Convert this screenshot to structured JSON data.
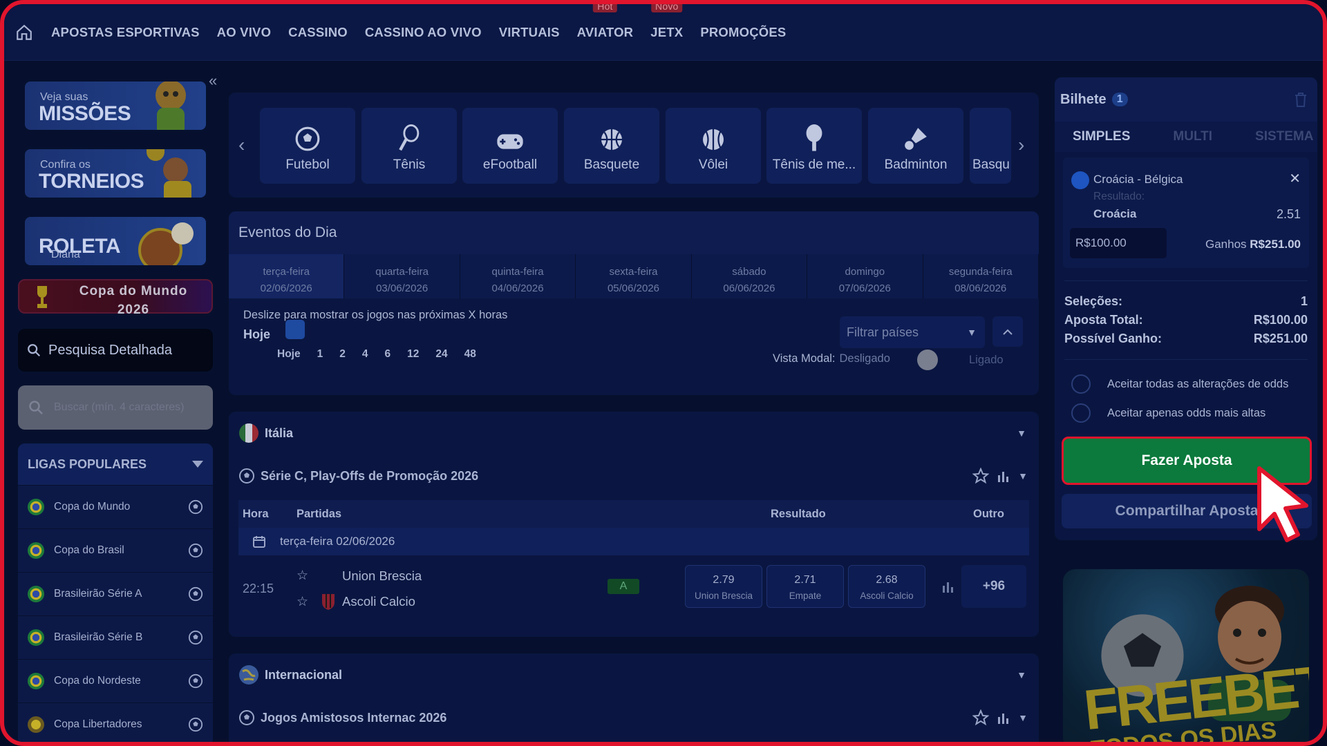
{
  "nav": {
    "items": [
      {
        "label": "APOSTAS ESPORTIVAS",
        "badge": ""
      },
      {
        "label": "AO VIVO",
        "badge": ""
      },
      {
        "label": "CASSINO",
        "badge": ""
      },
      {
        "label": "CASSINO AO VIVO",
        "badge": ""
      },
      {
        "label": "VIRTUAIS",
        "badge": ""
      },
      {
        "label": "AVIATOR",
        "badge": "Hot"
      },
      {
        "label": "JETX",
        "badge": "Novo"
      },
      {
        "label": "PROMOÇÕES",
        "badge": ""
      }
    ]
  },
  "sidebar": {
    "promos": [
      {
        "small": "Veja suas",
        "big": "MISSÕES"
      },
      {
        "small": "Confira os",
        "big": "TORNEIOS"
      },
      {
        "small": "Diária",
        "big": "ROLETA"
      }
    ],
    "copa": {
      "line1": "Copa do Mundo",
      "line2": "2026"
    },
    "detailed_search": "Pesquisa Detalhada",
    "search_placeholder": "Buscar (mín. 4 caracteres)",
    "ligas_title": "LIGAS POPULARES",
    "ligas": [
      "Copa do Mundo",
      "Copa do Brasil",
      "Brasileirão Série A",
      "Brasileirão Série B",
      "Copa do Nordeste",
      "Copa Libertadores"
    ]
  },
  "sports": [
    "Futebol",
    "Tênis",
    "eFootball",
    "Basquete",
    "Vôlei",
    "Tênis de me...",
    "Badminton",
    "Basqu"
  ],
  "eventos": {
    "title": "Eventos do Dia",
    "days": [
      {
        "name": "terça-feira",
        "date": "02/06/2026"
      },
      {
        "name": "quarta-feira",
        "date": "03/06/2026"
      },
      {
        "name": "quinta-feira",
        "date": "04/06/2026"
      },
      {
        "name": "sexta-feira",
        "date": "05/06/2026"
      },
      {
        "name": "sábado",
        "date": "06/06/2026"
      },
      {
        "name": "domingo",
        "date": "07/06/2026"
      },
      {
        "name": "segunda-feira",
        "date": "08/06/2026"
      }
    ],
    "slider_text": "Deslize para mostrar os jogos nas próximas X horas",
    "hoje": "Hoje",
    "hours": [
      "Hoje",
      "1",
      "2",
      "4",
      "6",
      "12",
      "24",
      "48"
    ],
    "filter_placeholder": "Filtrar países",
    "vista_label": "Vista Modal:",
    "vista_off": "Desligado",
    "vista_on": "Ligado"
  },
  "competitions": [
    {
      "country": "Itália",
      "league": "Série C, Play-Offs de Promoção 2026",
      "headers": {
        "hora": "Hora",
        "partidas": "Partidas",
        "resultado": "Resultado",
        "outro": "Outro"
      },
      "date": "terça-feira 02/06/2026",
      "match": {
        "time": "22:15",
        "home": "Union Brescia",
        "away": "Ascoli Calcio",
        "badge": "A",
        "odds": [
          {
            "value": "2.79",
            "name": "Union Brescia"
          },
          {
            "value": "2.71",
            "name": "Empate"
          },
          {
            "value": "2.68",
            "name": "Ascoli Calcio"
          }
        ],
        "more": "+96"
      }
    },
    {
      "country": "Internacional",
      "league": "Jogos Amistosos Internac 2026"
    }
  ],
  "slip": {
    "title": "Bilhete",
    "count": "1",
    "tabs": [
      "SIMPLES",
      "MULTI",
      "SISTEMA"
    ],
    "selection": {
      "match": "Croácia - Bélgica",
      "result_label": "Resultado:",
      "pick": "Croácia",
      "odd": "2.51",
      "stake": "R$100.00",
      "ganhos_label": "Ganhos",
      "ganhos_value": "R$251.00"
    },
    "summary": [
      {
        "label": "Seleções:",
        "value": "1"
      },
      {
        "label": "Aposta Total:",
        "value": "R$100.00"
      },
      {
        "label": "Possível Ganho:",
        "value": "R$251.00"
      }
    ],
    "options": [
      "Aceitar todas as alterações de odds",
      "Aceitar apenas odds mais altas"
    ],
    "bet_button": "Fazer Aposta",
    "share_button": "Compartilhar Aposta"
  },
  "banner": {
    "text": "FREEBET",
    "sub": "TODOS OS DIAS"
  },
  "colors": {
    "accent_red": "#e1152d",
    "bet_green": "#0b7a3c",
    "nav_bg": "#0b1744"
  }
}
